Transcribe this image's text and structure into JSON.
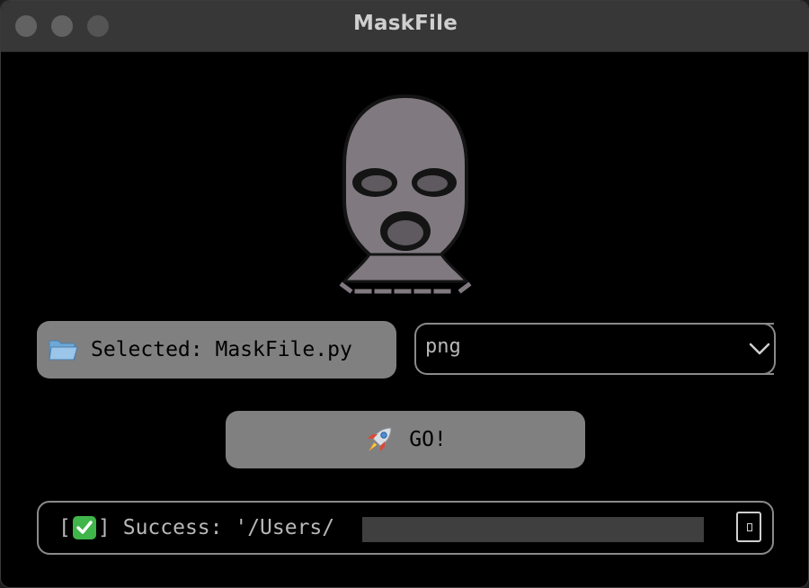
{
  "window": {
    "title": "MaskFile"
  },
  "logo": {
    "icon": "ski-mask-icon",
    "fill_color": "#807a80",
    "outline_color": "#141414"
  },
  "file_picker": {
    "icon": "folder-icon",
    "label": "Selected: MaskFile.py"
  },
  "format_select": {
    "value": "png",
    "icon": "chevron-down-icon"
  },
  "go_button": {
    "icon": "rocket-icon",
    "label": "GO!"
  },
  "status": {
    "prefix_open": "[",
    "icon": "check-mark-icon",
    "prefix_close": "]",
    "message": "Success: '/Users/",
    "copy_icon": "copy-icon"
  },
  "colors": {
    "window_bg": "#000000",
    "titlebar_bg": "#373737",
    "button_bg": "#808080",
    "border": "#8a8a8a",
    "text_light": "#b8b8b8",
    "success_green": "#3fb54a"
  }
}
